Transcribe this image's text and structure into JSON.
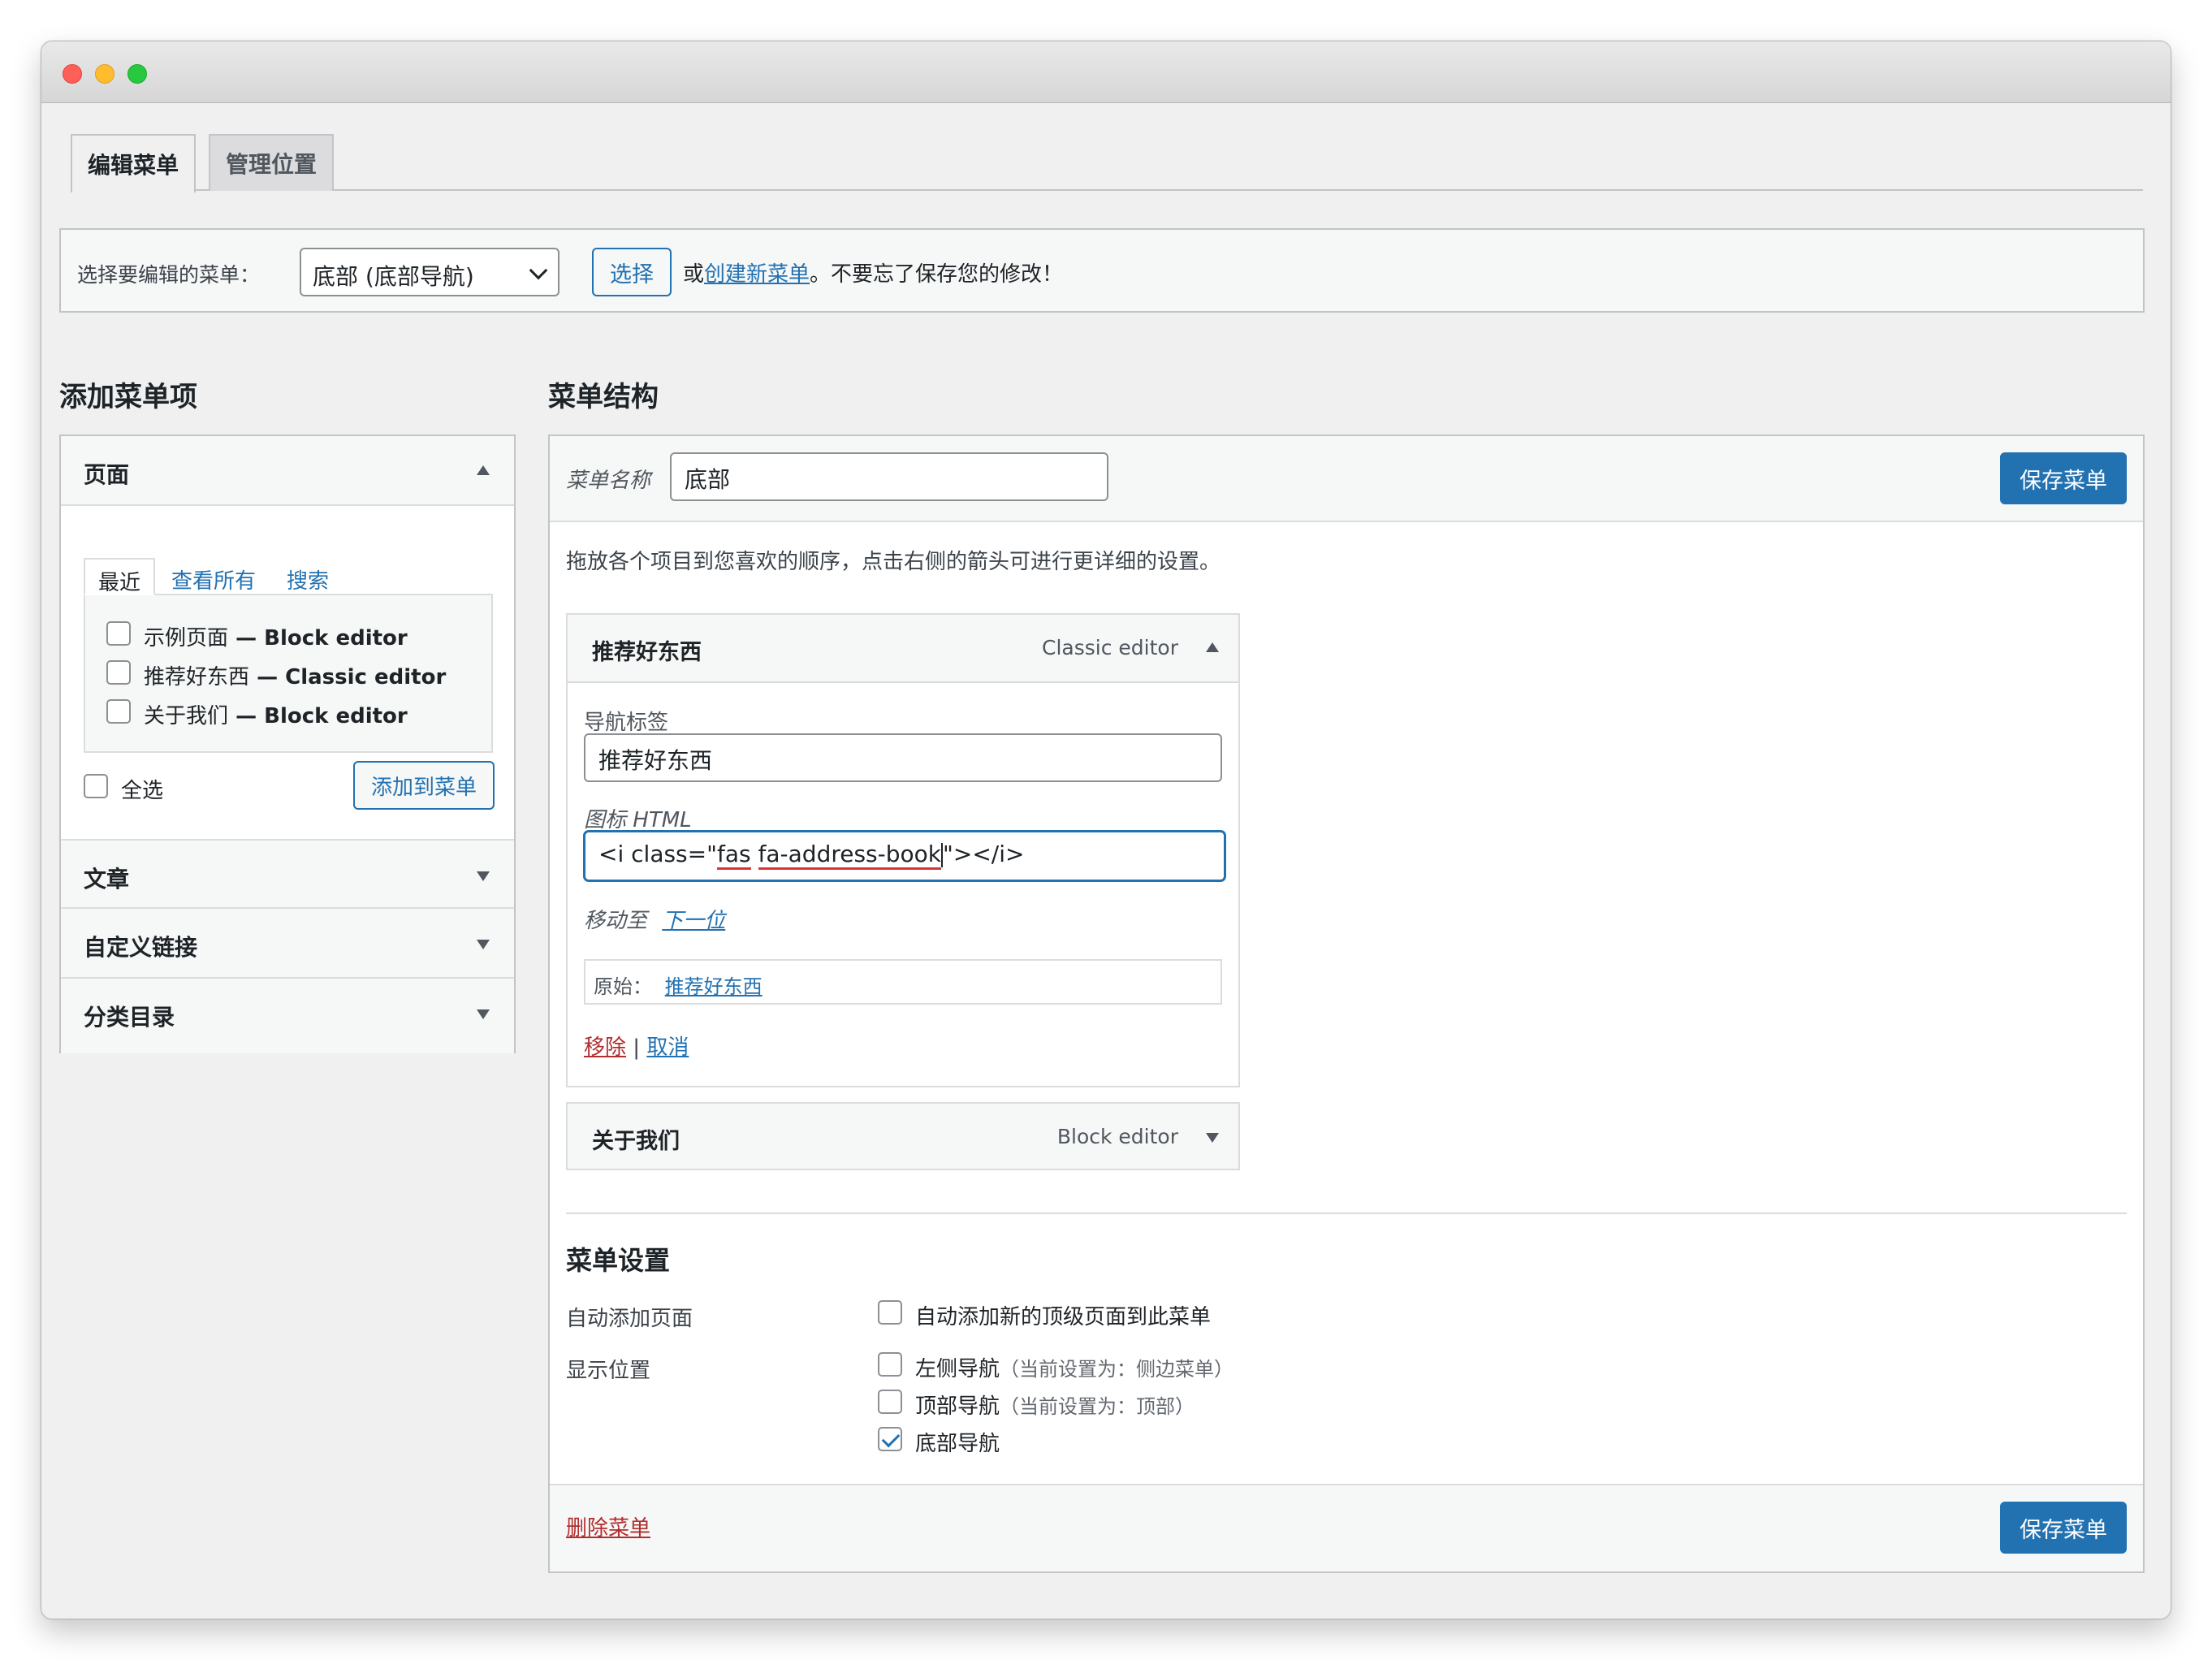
{
  "tabs": {
    "edit": "编辑菜单",
    "locations": "管理位置"
  },
  "select_bar": {
    "label": "选择要编辑的菜单：",
    "selected": "底部 (底部导航)",
    "select_button": "选择",
    "or_text": "或",
    "create_link": "创建新菜单",
    "reminder": "。不要忘了保存您的修改！"
  },
  "left": {
    "heading": "添加菜单项",
    "pages": {
      "title": "页面",
      "tabs": {
        "recent": "最近",
        "all": "查看所有",
        "search": "搜索"
      },
      "items": [
        {
          "name": "示例页面",
          "sep": " — ",
          "type": "Block editor"
        },
        {
          "name": "推荐好东西",
          "sep": " — ",
          "type": "Classic editor"
        },
        {
          "name": "关于我们",
          "sep": " — ",
          "type": "Block editor"
        }
      ],
      "select_all": "全选",
      "add_button": "添加到菜单"
    },
    "sections": {
      "posts": "文章",
      "custom_links": "自定义链接",
      "categories": "分类目录"
    }
  },
  "right": {
    "heading": "菜单结构",
    "menu_name_label": "菜单名称",
    "menu_name_value": "底部",
    "save_button": "保存菜单",
    "instructions": "拖放各个项目到您喜欢的顺序，点击右侧的箭头可进行更详细的设置。",
    "item1": {
      "title": "推荐好东西",
      "type": "Classic editor",
      "nav_label": "导航标签",
      "nav_value": "推荐好东西",
      "icon_label": "图标 HTML",
      "icon_value": {
        "pre": "<i class=\"",
        "w1": "fas",
        "sp": " ",
        "w2": "fa-address-book",
        "post": "\"></i>"
      },
      "move_label": "移动至",
      "move_link": "下一位",
      "original_label": "原始：",
      "original_link": "推荐好东西",
      "remove": "移除",
      "pipe": " | ",
      "cancel": "取消"
    },
    "item2": {
      "title": "关于我们",
      "type": "Block editor"
    },
    "settings": {
      "heading": "菜单设置",
      "auto_add_label": "自动添加页面",
      "auto_add_option": "自动添加新的顶级页面到此菜单",
      "display_label": "显示位置",
      "locations": [
        {
          "name": "左侧导航",
          "note": "（当前设置为：侧边菜单）",
          "checked": false
        },
        {
          "name": "顶部导航",
          "note": "（当前设置为：顶部）",
          "checked": false
        },
        {
          "name": "底部导航",
          "note": "",
          "checked": true
        }
      ]
    },
    "delete_link": "删除菜单"
  },
  "colors": {
    "accent": "#2271b1",
    "danger": "#b32d2e",
    "background": "#f0f0f1"
  }
}
